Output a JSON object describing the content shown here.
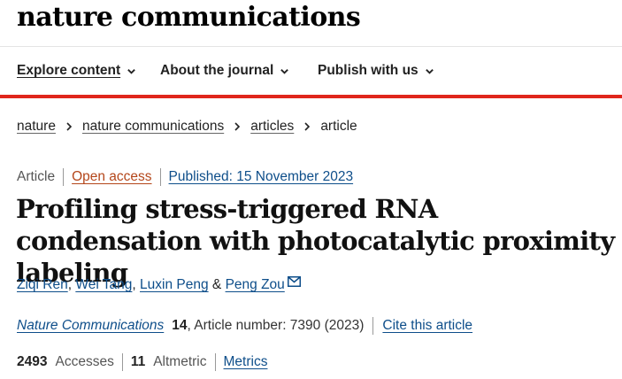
{
  "header": {
    "logo": "nature communications"
  },
  "nav": {
    "items": [
      {
        "label": "Explore content"
      },
      {
        "label": "About the journal"
      },
      {
        "label": "Publish with us"
      }
    ]
  },
  "breadcrumb": {
    "items": [
      "nature",
      "nature communications",
      "articles"
    ],
    "current": "article"
  },
  "meta": {
    "type": "Article",
    "open_access": "Open access",
    "published": "Published: 15 November 2023"
  },
  "article": {
    "title": "Profiling stress-triggered RNA condensation with photocatalytic proximity labeling",
    "authors": [
      "Ziqi Ren",
      "Wei Tang",
      "Luxin Peng",
      "Peng Zou"
    ],
    "author_sep": ",",
    "author_and": "&"
  },
  "citation": {
    "journal": "Nature Communications",
    "volume": "14",
    "article_number": ", Article number: 7390 (2023)",
    "cite_link": "Cite this article"
  },
  "metrics": {
    "accesses_value": "2493",
    "accesses_label": "Accesses",
    "altmetric_value": "11",
    "altmetric_label": "Altmetric",
    "metrics_link": "Metrics"
  },
  "colors": {
    "accent_red": "#e0261c",
    "link_blue": "#0e4e8a",
    "open_access_orange": "#b4461a"
  },
  "icons": {
    "nav_chevron": "chevron-down-icon",
    "breadcrumb_separator": "chevron-right-icon",
    "corresponding_author": "mail-icon"
  }
}
